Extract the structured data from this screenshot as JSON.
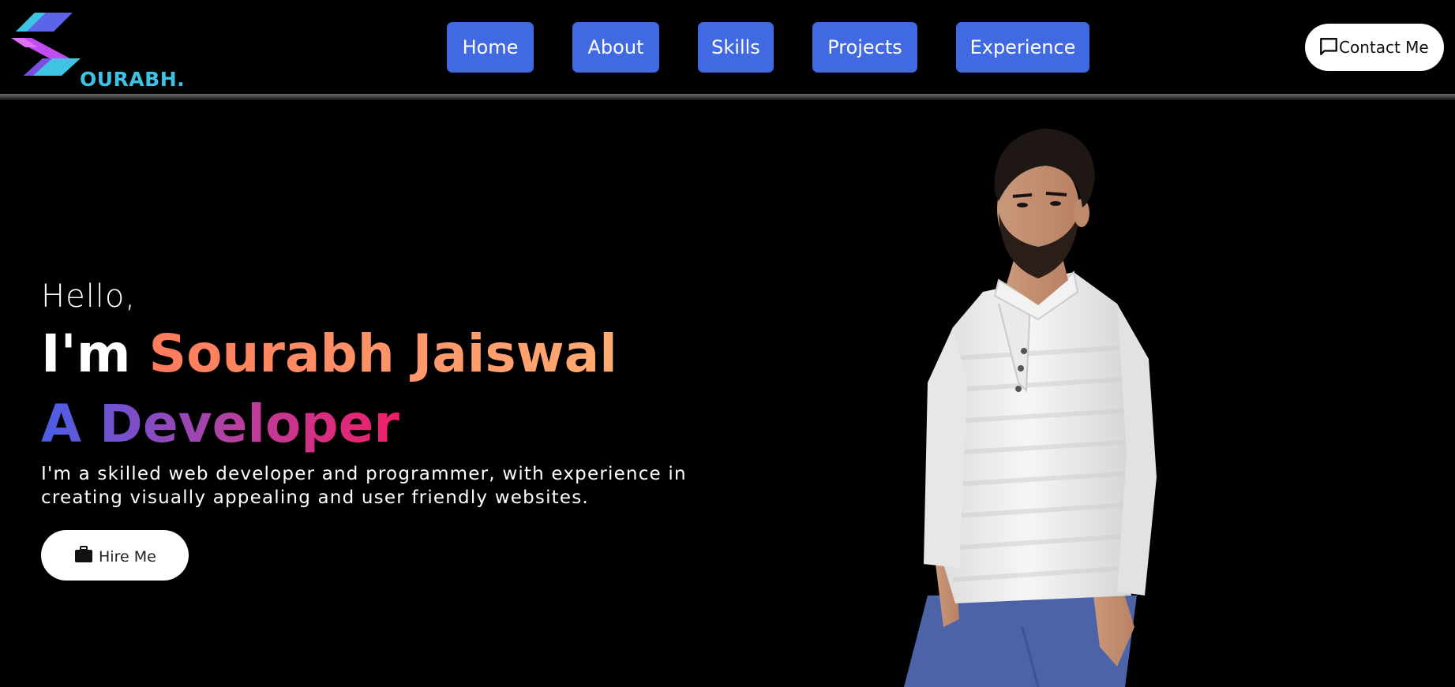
{
  "brand": {
    "logo_text": "OURABH.",
    "colors": {
      "purple": "#c14cf2",
      "cyan": "#3ec3e2"
    }
  },
  "nav": {
    "items": [
      {
        "label": "Home"
      },
      {
        "label": "About"
      },
      {
        "label": "Skills"
      },
      {
        "label": "Projects"
      },
      {
        "label": "Experience"
      }
    ],
    "button_color": "#4169e1"
  },
  "contact": {
    "label": "Contact Me",
    "icon": "chat-bubble-icon"
  },
  "hero": {
    "greeting": "Hello,",
    "intro_prefix": "I'm",
    "name": "Sourabh Jaiswal",
    "role": "A Developer",
    "description": "I'm a skilled web developer and programmer, with experience in creating visually appealing and user friendly websites.",
    "hire_label": "Hire Me",
    "hire_icon": "briefcase-icon"
  },
  "portrait": {
    "subject": "portrait-photo"
  }
}
